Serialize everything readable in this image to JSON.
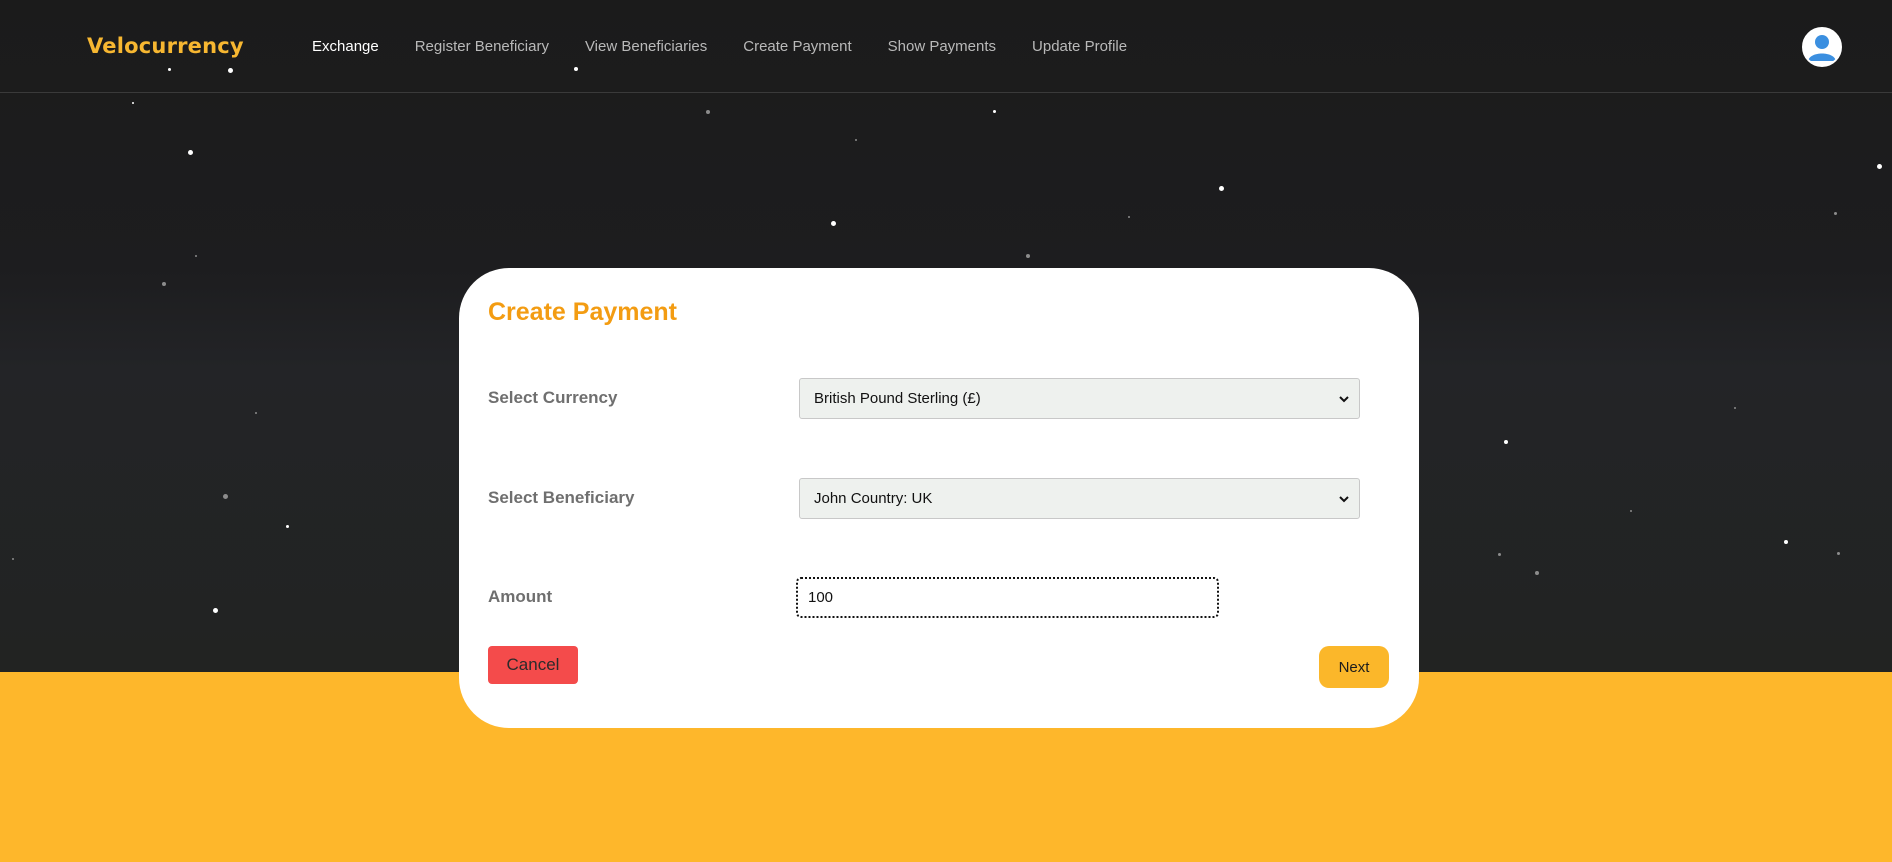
{
  "brand": {
    "name": "Velocurrency"
  },
  "nav": {
    "items": [
      {
        "label": "Exchange",
        "active": true
      },
      {
        "label": "Register Beneficiary",
        "active": false
      },
      {
        "label": "View Beneficiaries",
        "active": false
      },
      {
        "label": "Create Payment",
        "active": false
      },
      {
        "label": "Show Payments",
        "active": false
      },
      {
        "label": "Update Profile",
        "active": false
      }
    ],
    "avatar_icon": "user-avatar-icon"
  },
  "form": {
    "title": "Create Payment",
    "currency": {
      "label": "Select Currency",
      "value": "British Pound Sterling (£)"
    },
    "beneficiary": {
      "label": "Select Beneficiary",
      "value": "John Country: UK"
    },
    "amount": {
      "label": "Amount",
      "value": "100"
    },
    "cancel_label": "Cancel",
    "next_label": "Next"
  },
  "colors": {
    "brand": "#f7b731",
    "accent": "#feb72b",
    "title": "#f39c12",
    "cancel": "#f44b4b",
    "background": "#1c1c1c"
  }
}
